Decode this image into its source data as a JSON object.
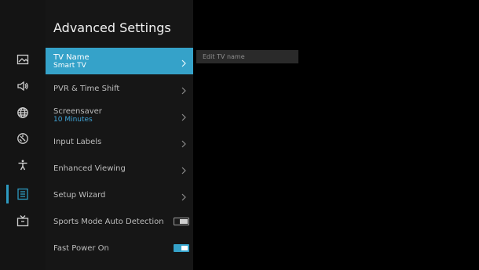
{
  "page": {
    "title": "Advanced Settings"
  },
  "rail": {
    "items": [
      {
        "icon": "picture-icon",
        "active": false
      },
      {
        "icon": "sound-icon",
        "active": false
      },
      {
        "icon": "globe-icon",
        "active": false
      },
      {
        "icon": "support-icon",
        "active": false
      },
      {
        "icon": "accessibility-icon",
        "active": false
      },
      {
        "icon": "list-icon",
        "active": true
      },
      {
        "icon": "tv-icon",
        "active": false
      }
    ],
    "active_color": "#2d9ac1"
  },
  "menu": {
    "items": [
      {
        "label": "TV Name",
        "sub": "Smart TV",
        "control": "chevron",
        "selected": true
      },
      {
        "label": "PVR & Time Shift",
        "control": "chevron"
      },
      {
        "label": "Screensaver",
        "sub": "10 Minutes",
        "control": "chevron"
      },
      {
        "label": "Input Labels",
        "control": "chevron"
      },
      {
        "label": "Enhanced Viewing",
        "control": "chevron"
      },
      {
        "label": "Setup Wizard",
        "control": "chevron"
      },
      {
        "label": "Sports Mode Auto Detection",
        "control": "toggle",
        "toggle_on": false
      },
      {
        "label": "Fast Power On",
        "control": "toggle",
        "toggle_on": true
      }
    ],
    "selected_color": "#35a2c9",
    "sub_color": "#3fa3d6"
  },
  "edit": {
    "placeholder": "Edit TV name"
  }
}
